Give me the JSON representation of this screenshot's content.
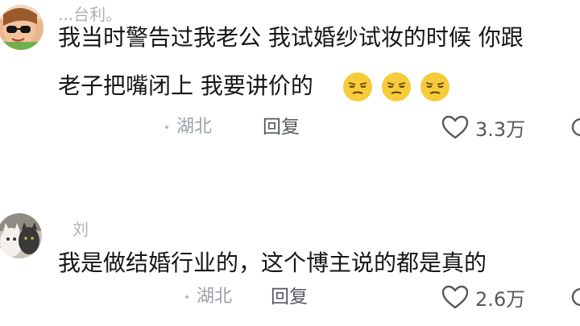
{
  "comments": [
    {
      "username": "...台利。",
      "text_line1": "我当时警告过我老公 我试婚纱试妆的时候 你跟",
      "text_line2": "老子把嘴闭上  我要讲价的",
      "emoji_icons": [
        "smirk-face-icon",
        "smirk-face-icon",
        "smirk-face-icon"
      ],
      "location": "湖北",
      "reply_label": "回复",
      "like_count": "3.3万"
    },
    {
      "username": "刘",
      "text_line1": "我是做结婚行业的，这个博主说的都是真的",
      "location": "湖北",
      "reply_label": "回复",
      "like_count": "2.6万"
    }
  ],
  "colors": {
    "text": "#161616",
    "meta": "#9aa0a6",
    "action": "#54595f",
    "emoji_yellow": "#f7cb3a"
  }
}
